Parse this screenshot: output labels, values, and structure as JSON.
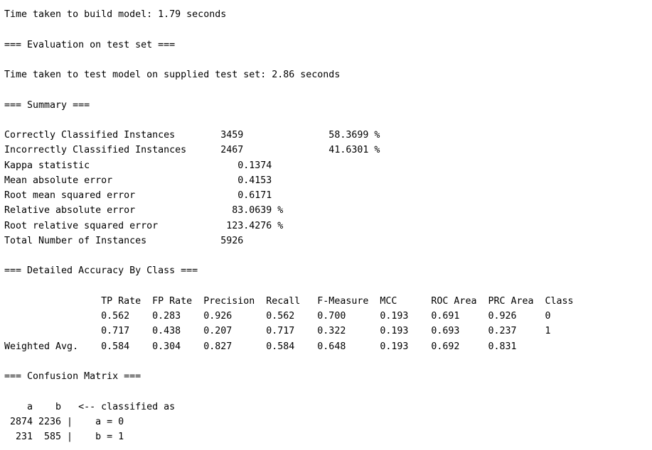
{
  "output": {
    "lines": [
      "Time taken to build model: 1.79 seconds",
      "",
      "=== Evaluation on test set ===",
      "",
      "Time taken to test model on supplied test set: 2.86 seconds",
      "",
      "=== Summary ===",
      "",
      "Correctly Classified Instances        3459               58.3699 %",
      "Incorrectly Classified Instances      2467               41.6301 %",
      "Kappa statistic                          0.1374",
      "Mean absolute error                      0.4153",
      "Root mean squared error                  0.6171",
      "Relative absolute error                 83.0639 %",
      "Root relative squared error            123.4276 %",
      "Total Number of Instances             5926     ",
      "",
      "=== Detailed Accuracy By Class ===",
      "",
      "                 TP Rate  FP Rate  Precision  Recall   F-Measure  MCC      ROC Area  PRC Area  Class",
      "                 0.562    0.283    0.926      0.562    0.700      0.193    0.691     0.926     0",
      "                 0.717    0.438    0.207      0.717    0.322      0.193    0.693     0.237     1",
      "Weighted Avg.    0.584    0.304    0.827      0.584    0.648      0.193    0.692     0.831     ",
      "",
      "=== Confusion Matrix ===",
      "",
      "    a    b   <-- classified as",
      " 2874 2236 |    a = 0",
      "  231  585 |    b = 1"
    ]
  }
}
